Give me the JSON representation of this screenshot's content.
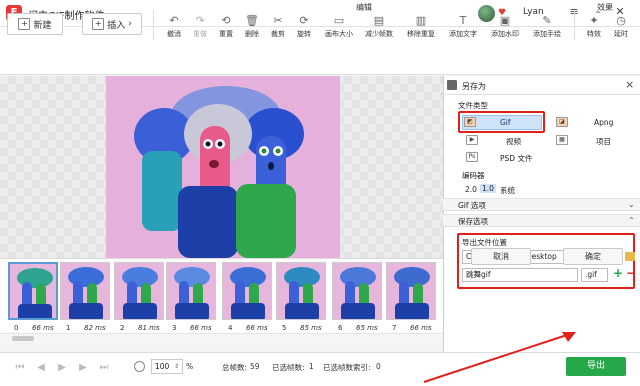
{
  "app": {
    "title": "闪电GIF制作软件",
    "logo_text": "F",
    "username": "Lyan"
  },
  "toolbar": {
    "new_label": "新建",
    "insert_label": "插入",
    "edit_group": "编辑",
    "effect_group": "效果",
    "tools": [
      {
        "label": "撤消",
        "icon": "↶",
        "disabled": false
      },
      {
        "label": "重做",
        "icon": "↷",
        "disabled": true
      },
      {
        "label": "重置",
        "icon": "⟲",
        "disabled": false
      },
      {
        "label": "删除",
        "icon": "🗑",
        "disabled": false
      },
      {
        "label": "裁剪",
        "icon": "✂",
        "disabled": false
      },
      {
        "label": "旋转",
        "icon": "⟳",
        "disabled": false
      },
      {
        "label": "画布大小",
        "icon": "▭",
        "disabled": false
      },
      {
        "label": "减少帧数",
        "icon": "▤",
        "disabled": false
      },
      {
        "label": "移除重复",
        "icon": "▥",
        "disabled": false
      },
      {
        "label": "添加文字",
        "icon": "T",
        "disabled": false
      },
      {
        "label": "添加水印",
        "icon": "▣",
        "disabled": false
      },
      {
        "label": "添加手绘",
        "icon": "✎",
        "disabled": false
      }
    ],
    "effect_tools": [
      {
        "label": "特效",
        "icon": "✦"
      },
      {
        "label": "延时",
        "icon": "◷"
      }
    ]
  },
  "saveas": {
    "title": "另存为",
    "close": "×",
    "filetype_label": "文件类型",
    "formats": [
      {
        "label": "Gif",
        "selected": true
      },
      {
        "label": "Apng",
        "selected": false
      },
      {
        "label": "视频",
        "selected": false
      },
      {
        "label": "项目",
        "selected": false
      },
      {
        "label": "PSD 文件",
        "selected": false
      }
    ],
    "encoder_label": "编码器",
    "encoders": [
      "2.0",
      "1.0",
      "系统"
    ],
    "gif_options": "Gif 选项",
    "save_options": "保存选项",
    "export_location_label": "导出文件位置",
    "path": "C:\\Users\\admin\\Desktop",
    "filename": "跳舞gif",
    "extension": ".gif",
    "cancel": "取消",
    "confirm": "确定"
  },
  "frames": [
    {
      "index": "0",
      "ms": "66 ms"
    },
    {
      "index": "1",
      "ms": "82 ms"
    },
    {
      "index": "2",
      "ms": "81 ms"
    },
    {
      "index": "3",
      "ms": "66 ms"
    },
    {
      "index": "4",
      "ms": "66 ms"
    },
    {
      "index": "5",
      "ms": "85 ms"
    },
    {
      "index": "6",
      "ms": "65 ms"
    },
    {
      "index": "7",
      "ms": "66 ms"
    }
  ],
  "status": {
    "zoom": "100",
    "zoom_unit": "%",
    "total_label": "总帧数:",
    "total": "59",
    "selected_label": "已选帧数:",
    "selected": "1",
    "selindex_label": "已选帧数索引:",
    "selindex": "0",
    "export": "导出"
  },
  "colors": {
    "accent_red": "#e0201c",
    "export_green": "#25a74a",
    "brand_red": "#e5383b"
  }
}
